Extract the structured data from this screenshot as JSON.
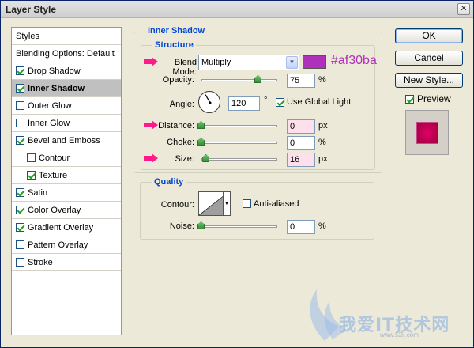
{
  "window": {
    "title": "Layer Style",
    "close_glyph": "✕"
  },
  "styles_panel": {
    "header": "Styles",
    "blending": "Blending Options: Default",
    "items": [
      {
        "label": "Drop Shadow",
        "checked": true,
        "indent": false,
        "selected": false
      },
      {
        "label": "Inner Shadow",
        "checked": true,
        "indent": false,
        "selected": true
      },
      {
        "label": "Outer Glow",
        "checked": false,
        "indent": false,
        "selected": false
      },
      {
        "label": "Inner Glow",
        "checked": false,
        "indent": false,
        "selected": false
      },
      {
        "label": "Bevel and Emboss",
        "checked": true,
        "indent": false,
        "selected": false
      },
      {
        "label": "Contour",
        "checked": false,
        "indent": true,
        "selected": false
      },
      {
        "label": "Texture",
        "checked": true,
        "indent": true,
        "selected": false
      },
      {
        "label": "Satin",
        "checked": true,
        "indent": false,
        "selected": false
      },
      {
        "label": "Color Overlay",
        "checked": true,
        "indent": false,
        "selected": false
      },
      {
        "label": "Gradient Overlay",
        "checked": true,
        "indent": false,
        "selected": false
      },
      {
        "label": "Pattern Overlay",
        "checked": false,
        "indent": false,
        "selected": false
      },
      {
        "label": "Stroke",
        "checked": false,
        "indent": false,
        "selected": false
      }
    ]
  },
  "inner_shadow": {
    "title": "Inner Shadow",
    "structure": {
      "title": "Structure",
      "blend_mode_label": "Blend Mode:",
      "blend_mode_value": "Multiply",
      "color": "#af30ba",
      "color_hex_label": "#af30ba",
      "opacity_label": "Opacity:",
      "opacity_value": "75",
      "opacity_unit": "%",
      "angle_label": "Angle:",
      "angle_value": "120",
      "angle_unit": "°",
      "global_light_label": "Use Global Light",
      "global_light_checked": true,
      "distance_label": "Distance:",
      "distance_value": "0",
      "distance_unit": "px",
      "choke_label": "Choke:",
      "choke_value": "0",
      "choke_unit": "%",
      "size_label": "Size:",
      "size_value": "16",
      "size_unit": "px"
    },
    "quality": {
      "title": "Quality",
      "contour_label": "Contour:",
      "anti_aliased_label": "Anti-aliased",
      "anti_aliased_checked": false,
      "noise_label": "Noise:",
      "noise_value": "0",
      "noise_unit": "%"
    }
  },
  "buttons": {
    "ok": "OK",
    "cancel": "Cancel",
    "new_style": "New Style...",
    "preview_label": "Preview",
    "preview_checked": true
  },
  "watermark": {
    "text": "我爱IT技术网",
    "url": "www.52ij.com"
  },
  "colors": {
    "accent": "#ff1493",
    "arrow": "#ff1a8c"
  }
}
